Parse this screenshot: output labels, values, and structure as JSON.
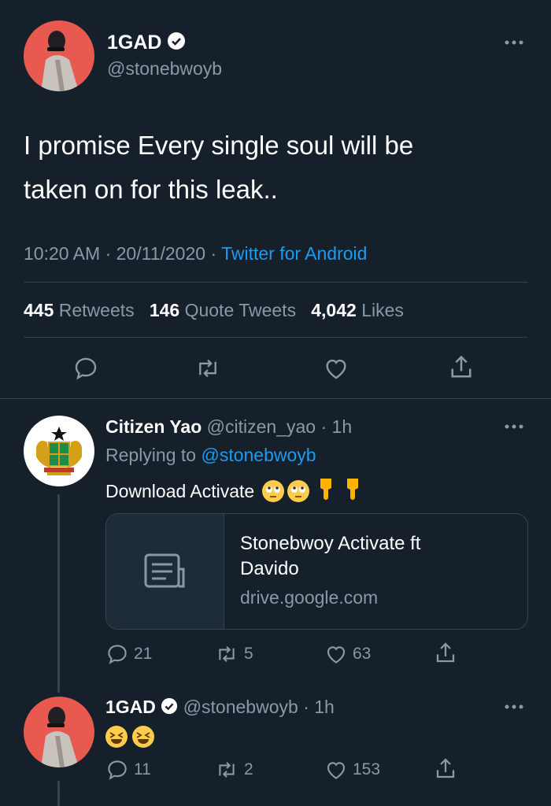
{
  "main_tweet": {
    "display_name": "1GAD",
    "handle": "@stonebwoyb",
    "text_line1": "I promise Every single soul will be",
    "text_line2": "taken on for this leak..",
    "time": "10:20 AM",
    "date": "20/11/2020",
    "source": "Twitter for Android",
    "stats": {
      "retweets_count": "445",
      "retweets_label": "Retweets",
      "quotes_count": "146",
      "quotes_label": "Quote Tweets",
      "likes_count": "4,042",
      "likes_label": "Likes"
    }
  },
  "reply1": {
    "display_name": "Citizen Yao",
    "handle": "@citizen_yao",
    "age": "1h",
    "replying_prefix": "Replying to",
    "replying_handle": "@stonebwoyb",
    "text": "Download Activate",
    "emojis": [
      "face-with-rolling-eyes",
      "face-with-rolling-eyes",
      "backhand-index-pointing-down",
      "backhand-index-pointing-down"
    ],
    "card": {
      "title_line1": "Stonebwoy Activate ft",
      "title_line2": "Davido",
      "domain": "drive.google.com",
      "icon": "document-icon"
    },
    "actions": {
      "replies": "21",
      "retweets": "5",
      "likes": "63"
    }
  },
  "reply2": {
    "display_name": "1GAD",
    "handle": "@stonebwoyb",
    "age": "1h",
    "emojis": [
      "grinning-squinting-face",
      "grinning-squinting-face"
    ],
    "actions": {
      "replies": "11",
      "retweets": "2",
      "likes": "153"
    }
  },
  "separator": "·",
  "colors": {
    "background": "#15202b",
    "accent": "#1d9bf0",
    "muted": "#8b98a5",
    "divider": "#38444d",
    "avatar_red": "#e85a4f"
  }
}
